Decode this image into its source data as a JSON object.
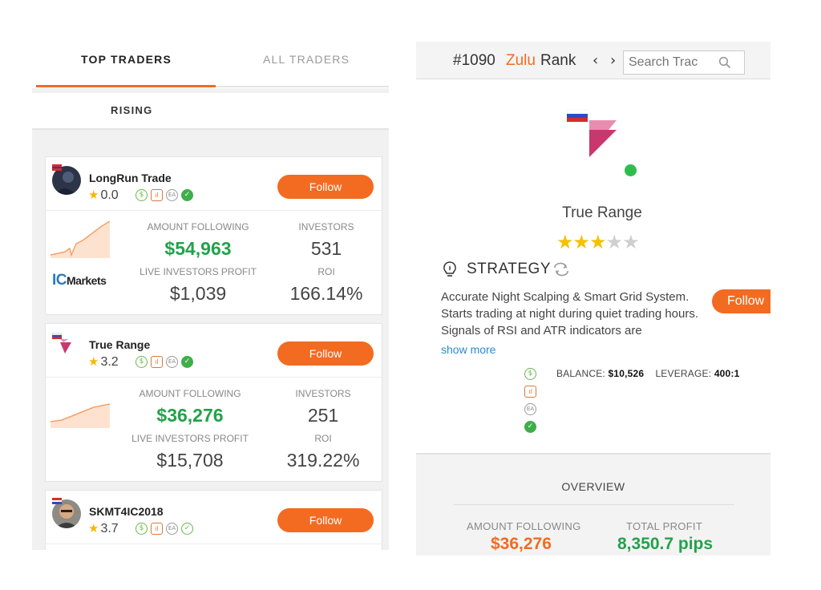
{
  "colors": {
    "accent": "#f26b21",
    "profit_green": "#22a24a",
    "star": "#f5b800",
    "online": "#2ebd4d",
    "link": "#2a8bd3"
  },
  "tabs": {
    "top": "TOP TRADERS",
    "all": "ALL TRADERS"
  },
  "subheader": "RISING",
  "traders": [
    {
      "name": "LongRun Trade",
      "rating": "0.0",
      "follow_label": "Follow",
      "amount_label": "AMOUNT FOLLOWING",
      "amount": "$54,963",
      "investors_label": "INVESTORS",
      "investors": "531",
      "profit_label": "LIVE INVESTORS PROFIT",
      "profit": "$1,039",
      "roi_label": "ROI",
      "roi": "166.14%",
      "broker_prefix": "IC",
      "broker_suffix": "Markets",
      "badges": [
        "dollar-icon",
        "chart-icon",
        "ea-icon",
        "verified-icon"
      ]
    },
    {
      "name": "True Range",
      "rating": "3.2",
      "follow_label": "Follow",
      "amount_label": "AMOUNT FOLLOWING",
      "amount": "$36,276",
      "investors_label": "INVESTORS",
      "investors": "251",
      "profit_label": "LIVE INVESTORS PROFIT",
      "profit": "$15,708",
      "roi_label": "ROI",
      "roi": "319.22%",
      "badges": [
        "dollar-icon",
        "chart-icon",
        "ea-icon",
        "verified-icon"
      ]
    },
    {
      "name": "SKMT4IC2018",
      "rating": "3.7",
      "follow_label": "Follow",
      "badges": [
        "dollar-icon",
        "chart-icon",
        "ea-icon",
        "verified-outline-icon"
      ]
    }
  ],
  "profile": {
    "rank_number": "#1090",
    "rank_brand": "Zulu",
    "rank_word": "Rank",
    "search_placeholder": "Search Trac",
    "name": "True Range",
    "stars_filled": 3,
    "stars_total": 5,
    "strategy_title": "STRATEGY",
    "strategy_text": "Accurate Night Scalping & Smart Grid System. Starts trading at night during quiet trading hours. Signals of RSI and ATR indicators are",
    "show_more": "show more",
    "follow_label": "Follow",
    "balance_label": "BALANCE:",
    "balance": "$10,526",
    "leverage_label": "LEVERAGE:",
    "leverage": "400:1",
    "overview_title": "OVERVIEW",
    "amount_following_label": "AMOUNT FOLLOWING",
    "amount_following": "$36,276",
    "total_profit_label": "TOTAL PROFIT",
    "total_profit": "8,350.7 pips"
  }
}
